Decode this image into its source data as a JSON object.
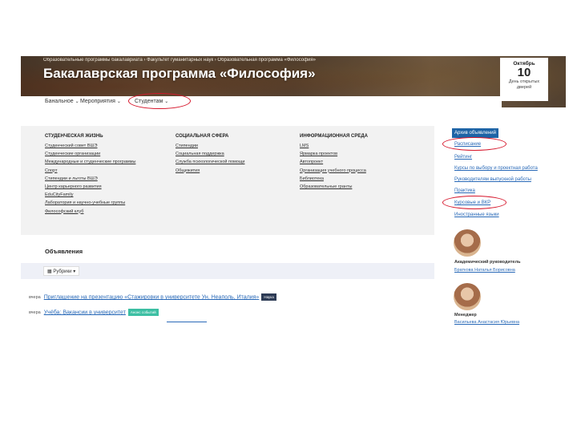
{
  "header": {
    "breadcrumb": "Образовательные программы бакалавриата › Факультет гуманитарных наук › Образовательная программа «Философия»",
    "title": "Бакалаврская программа «Философия»",
    "nav": [
      {
        "label": "Банальное",
        "chevron": "⌄"
      },
      {
        "label": "Мероприятия",
        "chevron": "⌄"
      },
      {
        "label": "Студентам",
        "chevron": "⌄"
      }
    ]
  },
  "calendar": {
    "month": "Октябрь",
    "day": "10",
    "text": "День открытых дверей"
  },
  "menu": {
    "columns": [
      {
        "heading": "СТУДЕНЧЕСКАЯ ЖИЗНЬ",
        "links": [
          "Студенческий совет ВШЭ",
          "Студенческие организации",
          "Международные и студенческие программы",
          "Спорт",
          "Стипендии и льготы ВШЭ",
          "Центр карьерного развития",
          "EduCityFamily",
          "Лаборатория и научно-учебные группы",
          "Философский клуб"
        ]
      },
      {
        "heading": "СОЦИАЛЬНАЯ СФЕРА",
        "links": [
          "Стипендии",
          "Социальная поддержка",
          "Служба психологической помощи",
          "Общежития"
        ]
      },
      {
        "heading": "ИНФОРМАЦИОННАЯ СРЕДА",
        "links": [
          "LMS",
          "Ярмарка проектов",
          "Автопроект",
          "Организация учебного процесса",
          "Библиотека",
          "Образовательные гранты"
        ]
      }
    ]
  },
  "announcements": {
    "title": "Объявления",
    "filter_label": "Рубрики",
    "filter_chevron": "▾",
    "filter_icon": "grid-icon",
    "items": [
      {
        "date": "вчера",
        "text": "Приглашение на презентацию «Стажировки в университете Ун. Неаполь, Италия»",
        "tag": "Наука",
        "tag_color": "#2d3b55"
      },
      {
        "date": "вчера",
        "text": "Учёба: Вакансии в университет",
        "tag": "Анонс событий",
        "tag_color": "#3dbfa3"
      }
    ]
  },
  "sidebar": {
    "header": "Архив объявлений",
    "links": [
      "Расписание",
      "Рейтинг",
      "Курсы по выбору и проектная работа",
      "Руководителям выпускной работы",
      "Практика",
      "Курсовые и ВКР",
      "Иностранные языки"
    ],
    "people": [
      {
        "role": "Академический руководитель",
        "name": "Браткова Наталья Борисовна"
      },
      {
        "role": "Менеджер",
        "name": "Васильева Анастасия Юрьевна"
      }
    ]
  },
  "colors": {
    "accent_blue": "#1e64a6",
    "highlight_red": "#d6162b",
    "panel_grey": "#f2f2f2"
  }
}
